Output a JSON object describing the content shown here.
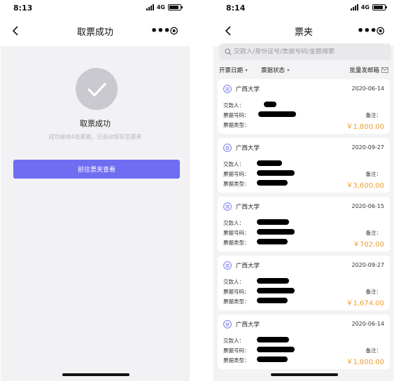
{
  "left": {
    "status": {
      "time": "8:13",
      "net": "4G"
    },
    "nav": {
      "title": "取票成功"
    },
    "success": {
      "title": "取票成功",
      "desc": "成功接收4张票据，已自动保存至票夹"
    },
    "button": {
      "label": "前往票夹查看"
    }
  },
  "right": {
    "status": {
      "time": "8:14",
      "net": "4G"
    },
    "nav": {
      "title": "票夹"
    },
    "search": {
      "placeholder": "交款人/身份证号/票据号码/金额搜索"
    },
    "filters": {
      "date": "开票日期",
      "status": "票据状态",
      "batch_mail": "批量发邮箱"
    },
    "card_labels": {
      "payer": "交款人：",
      "number": "票据号码：",
      "type": "票据类型：",
      "remark": "备注："
    },
    "cards": [
      {
        "school": "广西大学",
        "date": "2020-06-14",
        "amount": "￥1,800.00"
      },
      {
        "school": "广西大学",
        "date": "2020-09-27",
        "amount": "￥3,600.00"
      },
      {
        "school": "广西大学",
        "date": "2020-06-15",
        "amount": "￥702.00"
      },
      {
        "school": "广西大学",
        "date": "2020-09-27",
        "amount": "￥1,674.00"
      },
      {
        "school": "广西大学",
        "date": "2020-06-14",
        "amount": "￥1,800.00"
      }
    ]
  },
  "colors": {
    "primary_button": "#6f6ef2",
    "amount": "#f0a030",
    "success_circle": "#c9c9cf",
    "school_icon": "#7a7ae8"
  }
}
